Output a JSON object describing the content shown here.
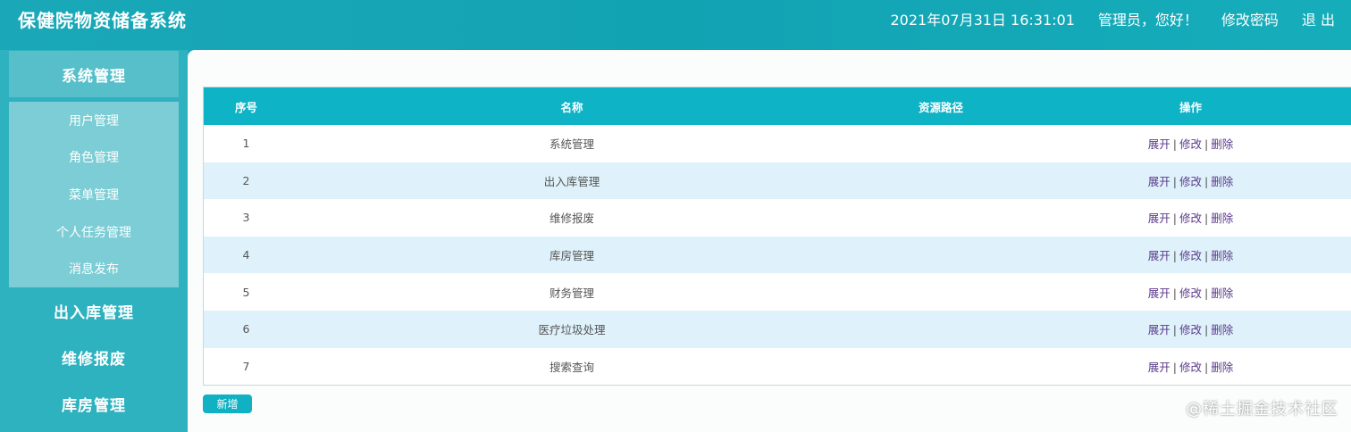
{
  "header": {
    "title": "保健院物资储备系统",
    "datetime": "2021年07月31日 16:31:01",
    "greeting": "管理员，您好！",
    "change_password": "修改密码",
    "logout": "退 出"
  },
  "sidebar": {
    "groups": [
      {
        "label": "系统管理",
        "expanded": true,
        "items": [
          {
            "label": "用户管理"
          },
          {
            "label": "角色管理"
          },
          {
            "label": "菜单管理"
          },
          {
            "label": "个人任务管理"
          },
          {
            "label": "消息发布"
          }
        ]
      },
      {
        "label": "出入库管理"
      },
      {
        "label": "维修报废"
      },
      {
        "label": "库房管理"
      }
    ]
  },
  "table": {
    "columns": [
      "序号",
      "名称",
      "资源路径",
      "操作"
    ],
    "rows": [
      {
        "index": "1",
        "name": "系统管理",
        "path": ""
      },
      {
        "index": "2",
        "name": "出入库管理",
        "path": ""
      },
      {
        "index": "3",
        "name": "维修报废",
        "path": ""
      },
      {
        "index": "4",
        "name": "库房管理",
        "path": ""
      },
      {
        "index": "5",
        "name": "财务管理",
        "path": ""
      },
      {
        "index": "6",
        "name": "医疗垃圾处理",
        "path": ""
      },
      {
        "index": "7",
        "name": "搜索查询",
        "path": ""
      }
    ],
    "actions": {
      "expand": "展开",
      "edit": "修改",
      "delete": "删除",
      "separator": "|"
    }
  },
  "add_button": "新增",
  "watermark": "@稀土掘金技术社区",
  "colors": {
    "header_bg": "#1aa8b8",
    "sidebar_bg": "#2fb2bf",
    "table_header_bg": "#0fb3c6",
    "row_alt_bg": "#dff2fb",
    "action_link": "#5a3a8a"
  }
}
